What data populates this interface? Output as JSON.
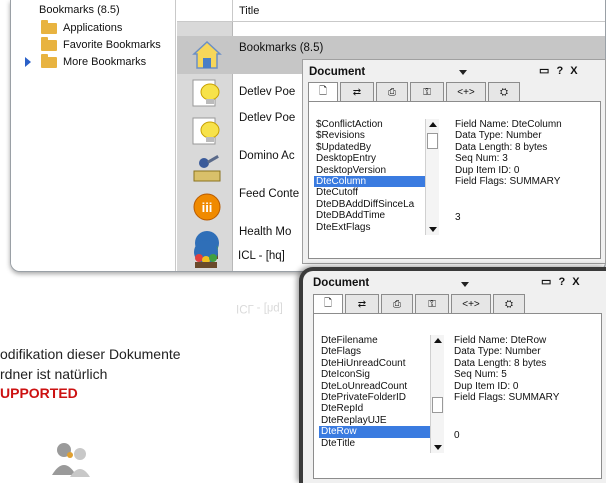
{
  "bookmarks_window": {
    "tree": [
      {
        "label": "Bookmarks (8.5)",
        "type": "root"
      },
      {
        "label": "Applications",
        "type": "folder"
      },
      {
        "label": "Favorite Bookmarks",
        "type": "folder"
      },
      {
        "label": "More Bookmarks",
        "type": "folder",
        "expandable": true
      }
    ],
    "column_header": "Title",
    "rows": [
      {
        "title": "Bookmarks (8.5)",
        "icon": "home-icon",
        "selected": true
      },
      {
        "title": "Detlev Poe",
        "icon": "lightbulb-icon"
      },
      {
        "title": "Detlev Poe",
        "icon": "lightbulb-icon"
      },
      {
        "title": "Domino Ac",
        "icon": "admin-tool-icon"
      },
      {
        "title": "Feed Conte",
        "icon": "feed-icon"
      },
      {
        "title": "Health Mo",
        "icon": "globe-people-icon"
      },
      {
        "title": "ICL - [hq]",
        "icon": "globe-people-icon"
      }
    ],
    "reflection_text": "ICL - [hq]"
  },
  "dialog_top": {
    "title": "Document",
    "controls": "▭ ? X",
    "tabs": [
      "🗋",
      "⇄",
      "⎙",
      "⚿",
      "<+>",
      "⛭"
    ],
    "fields": [
      "$ConflictAction",
      "$Revisions",
      "$UpdatedBy",
      "DesktopEntry",
      "DesktopVersion",
      "DteColumn",
      "DteCutoff",
      "DteDBAddDiffSinceLa",
      "DteDBAddTime",
      "DteExtFlags"
    ],
    "selected_index": 5,
    "info": [
      "Field Name: DteColumn",
      "Data Type: Number",
      "Data Length: 8 bytes",
      "Seq Num: 3",
      "Dup Item ID: 0",
      "Field Flags: SUMMARY"
    ],
    "value": "3"
  },
  "dialog_bottom": {
    "title": "Document",
    "controls": "▭ ? X",
    "tabs": [
      "🗋",
      "⇄",
      "⎙",
      "⚿",
      "<+>",
      "⛭"
    ],
    "fields": [
      "DteFilename",
      "DteFlags",
      "DteHiUnreadCount",
      "DteIconSig",
      "DteLoUnreadCount",
      "DtePrivateFolderID",
      "DteRepId",
      "DteReplayUJE",
      "DteRow",
      "DteTitle"
    ],
    "selected_index": 8,
    "info": [
      "Field Name: DteRow",
      "Data Type: Number",
      "Data Length: 8 bytes",
      "Seq Num: 5",
      "Dup Item ID: 0",
      "Field Flags: SUMMARY"
    ],
    "value": "0"
  },
  "slide_text": {
    "line1": "odifikation dieser Dokumente",
    "line2": "rdner ist natürlich",
    "line3": "UPPORTED"
  },
  "colors": {
    "accent_red": "#cc1111",
    "selection_blue": "#3a7be0",
    "folder": "#e8b340"
  }
}
